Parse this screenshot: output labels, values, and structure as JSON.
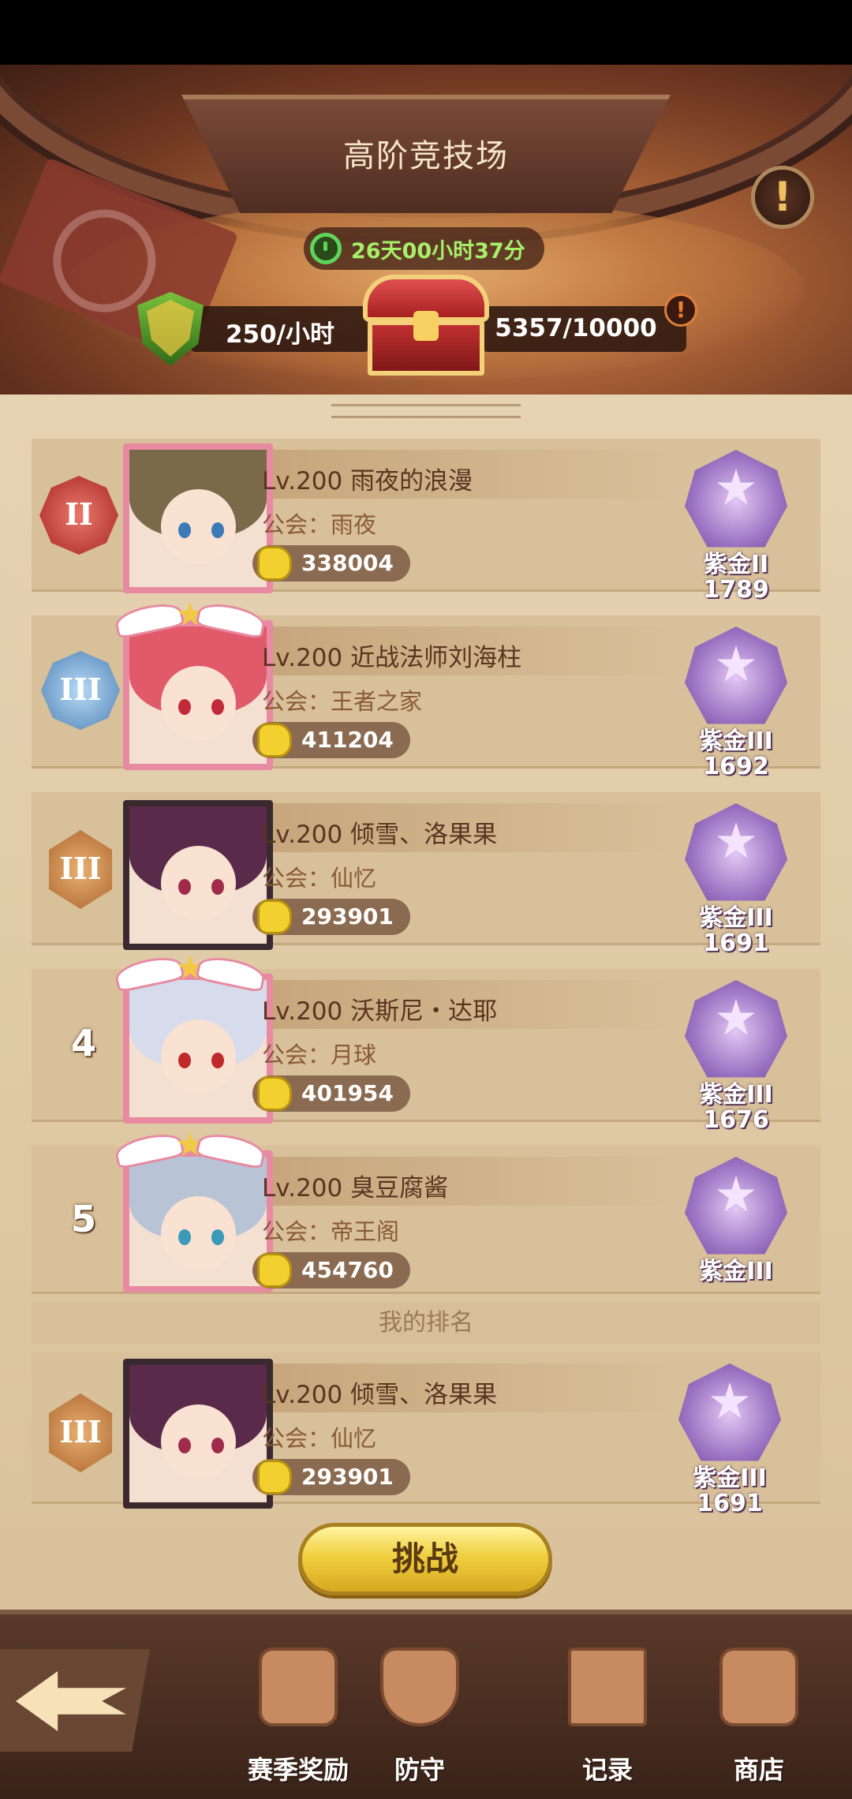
{
  "header": {
    "title": "高阶竞技场",
    "timer": "26天00小时37分",
    "rate": "250/小时",
    "progress_text": "5357/10000",
    "info_icon": "exclamation-icon"
  },
  "players": [
    {
      "rank": "1",
      "level": "Lv.200",
      "name": "雨夜的浪漫",
      "guild_prefix": "公会：",
      "guild": "雨夜",
      "power": "338004",
      "tier": "紫金II",
      "score": "1789"
    },
    {
      "rank": "2",
      "level": "Lv.200",
      "name": "近战法师刘海柱",
      "guild_prefix": "公会：",
      "guild": "王者之家",
      "power": "411204",
      "tier": "紫金III",
      "score": "1692"
    },
    {
      "rank": "3",
      "level": "Lv.200",
      "name": "倾雪、洛果果",
      "guild_prefix": "公会：",
      "guild": "仙忆",
      "power": "293901",
      "tier": "紫金III",
      "score": "1691"
    },
    {
      "rank": "4",
      "level": "Lv.200",
      "name": "沃斯尼・达耶",
      "guild_prefix": "公会：",
      "guild": "月球",
      "power": "401954",
      "tier": "紫金III",
      "score": "1676"
    },
    {
      "rank": "5",
      "level": "Lv.200",
      "name": "臭豆腐酱",
      "guild_prefix": "公会：",
      "guild": "帝王阁",
      "power": "454760",
      "tier": "紫金III",
      "score": ""
    }
  ],
  "my_rank": {
    "label": "我的排名",
    "rank": "3",
    "level": "Lv.200",
    "name": "倾雪、洛果果",
    "guild_prefix": "公会：",
    "guild": "仙忆",
    "power": "293901",
    "tier": "紫金III",
    "score": "1691"
  },
  "challenge_button": "挑战",
  "bottom_nav": [
    {
      "label": "赛季奖励",
      "icon": "chest-icon"
    },
    {
      "label": "防守",
      "icon": "shield-icon"
    },
    {
      "label": "记录",
      "icon": "scroll-icon"
    },
    {
      "label": "商店",
      "icon": "scales-icon"
    }
  ],
  "colors": {
    "accent": "#f0d040",
    "panel": "#d8c09a",
    "tier": "#9a72c2"
  }
}
